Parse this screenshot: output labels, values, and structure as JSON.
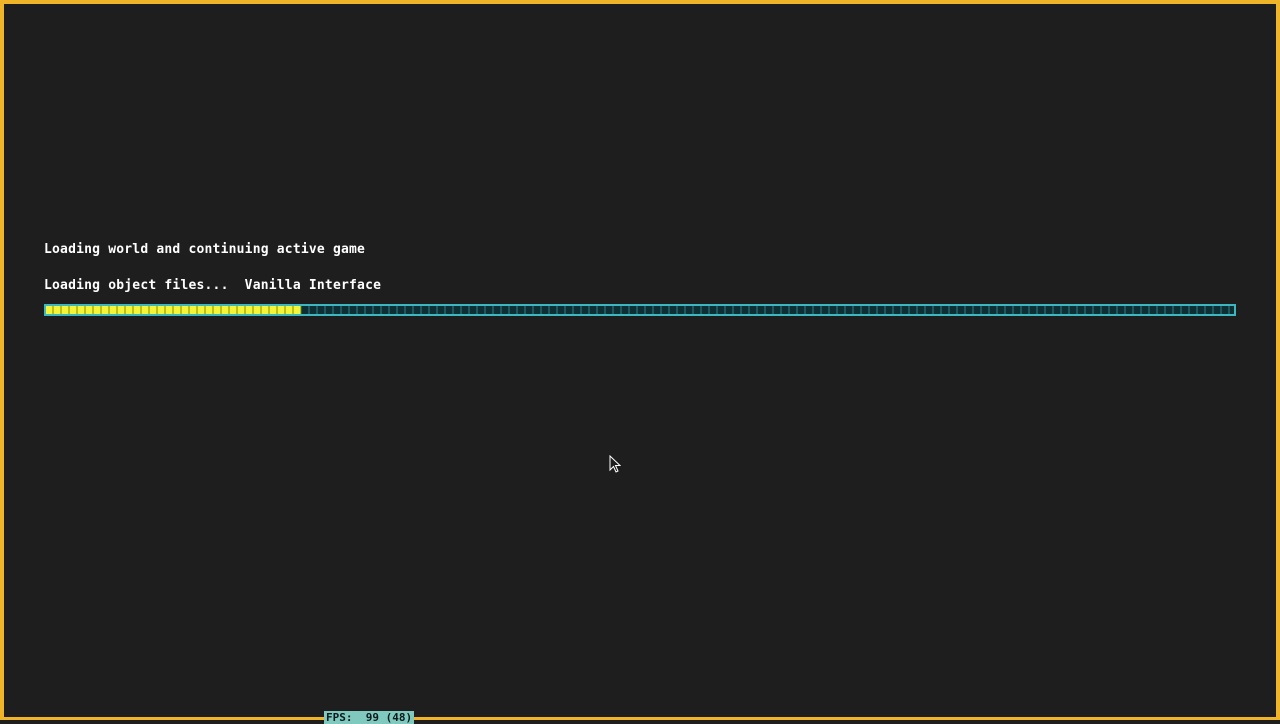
{
  "loading": {
    "title": "Loading world and continuing active game",
    "status": "Loading object files...  Vanilla Interface",
    "progress_fraction": 0.215
  },
  "fps": {
    "text": "FPS:  99 (48)"
  },
  "colors": {
    "border": "#f0b429",
    "background": "#1e1e1e",
    "progress_fill": "#f4f43a",
    "progress_border": "#3bb8bf",
    "fps_badge": "#7fc9bf"
  },
  "icons": {
    "cursor": "mouse-pointer-icon"
  }
}
